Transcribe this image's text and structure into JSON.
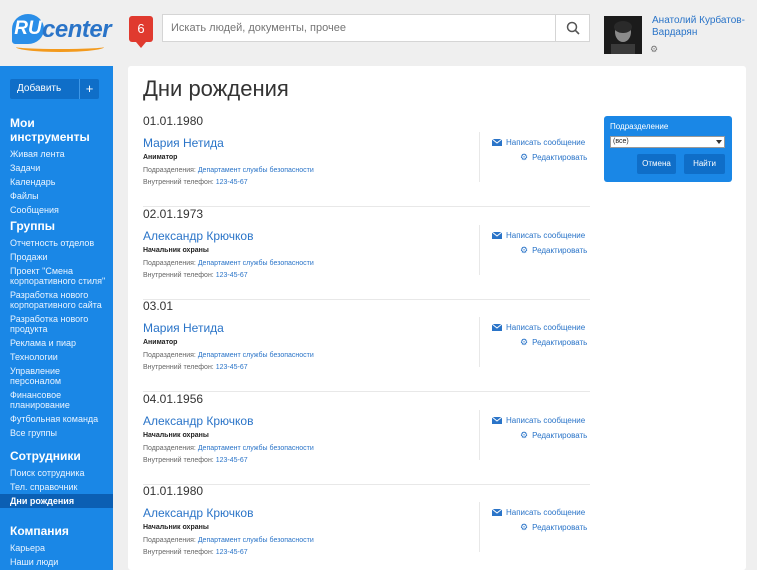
{
  "header": {
    "logo_prefix": "RU",
    "logo_text": "center",
    "notification_count": "6",
    "search_placeholder": "Искать людей, документы, прочее",
    "user_name": "Анатолий Курбатов-Вардарян"
  },
  "sidebar": {
    "add_label": "Добавить",
    "add_plus": "+",
    "sections": [
      {
        "title": "Мои инструменты",
        "items": [
          "Живая лента",
          "Задачи",
          "Календарь",
          "Файлы",
          "Сообщения"
        ]
      },
      {
        "title": "Группы",
        "items": [
          "Отчетность отделов",
          "Продажи",
          "Проект \"Смена корпоративного стиля\"",
          "Разработка нового корпоративного сайта",
          "Разработка нового продукта",
          "Реклама и пиар",
          "Технологии",
          "Управление персоналом",
          "Финансовое планирование",
          "Футбольная команда",
          "Все группы"
        ]
      },
      {
        "title": "Сотрудники",
        "items": [
          "Поиск сотрудника",
          "Тел. справочник",
          "Дни рождения"
        ]
      },
      {
        "title": "Компания",
        "items": [
          "Карьера",
          "Наши люди"
        ]
      }
    ]
  },
  "main": {
    "title": "Дни рождения",
    "dept_label": "Подразделения:",
    "phone_label": "Внутренний телефон:",
    "msg_label": "Написать сообщение",
    "edit_label": "Редактировать",
    "cards": [
      {
        "date": "01.01.1980",
        "name": "Мария Нетида",
        "role": "Аниматор",
        "dept": "Департамент службы безопасности",
        "phone": "123-45-67"
      },
      {
        "date": "02.01.1973",
        "name": "Александр Крючков",
        "role": "Начальник охраны",
        "dept": "Департамент службы безопасности",
        "phone": "123-45-67"
      },
      {
        "date": "03.01",
        "name": "Мария Нетида",
        "role": "Аниматор",
        "dept": "Департамент службы безопасности",
        "phone": "123-45-67"
      },
      {
        "date": "04.01.1956",
        "name": "Александр Крючков",
        "role": "Начальник охраны",
        "dept": "Департамент службы безопасности",
        "phone": "123-45-67"
      },
      {
        "date": "01.01.1980",
        "name": "Александр Крючков",
        "role": "Начальник охраны",
        "dept": "Департамент службы безопасности",
        "phone": "123-45-67"
      }
    ]
  },
  "filter": {
    "label": "Подразделение",
    "selected": "(все)",
    "cancel": "Отмена",
    "find": "Найти"
  }
}
